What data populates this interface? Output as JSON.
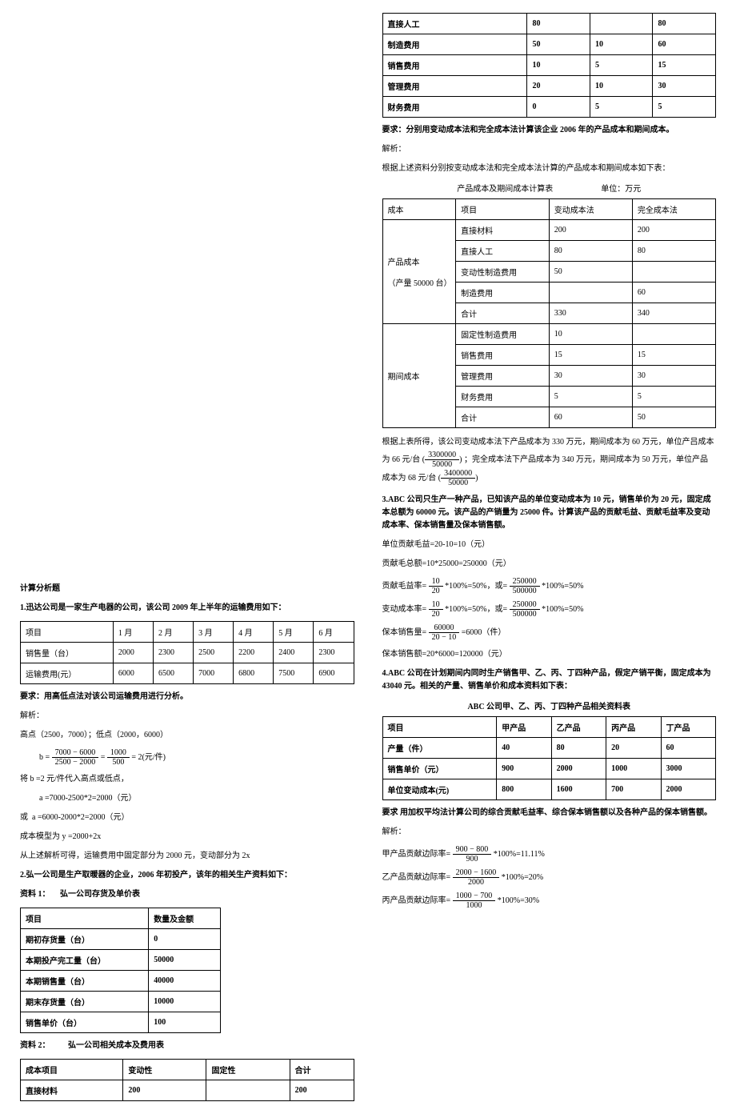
{
  "left": {
    "title": "计算分析题",
    "q1": {
      "stmt": "1.迅达公司是一家生产电器的公司，该公司 2009 年上半年的运输费用如下：",
      "table": {
        "h": [
          "项目",
          "1 月",
          "2 月",
          "3 月",
          "4 月",
          "5 月",
          "6 月"
        ],
        "r1": [
          "销售量（台）",
          "2000",
          "2300",
          "2500",
          "2200",
          "2400",
          "2300"
        ],
        "r2": [
          "运输费用(元）",
          "6000",
          "6500",
          "7000",
          "6800",
          "7500",
          "6900"
        ]
      },
      "req": "要求：用高低点法对该公司运输费用进行分析。",
      "sol_label": "解析：",
      "hl": "高点（2500，7000）；低点（2000，6000）",
      "b_num": "7000 − 6000",
      "b_den": "2500 − 2000",
      "b_num2": "1000",
      "b_den2": "500",
      "b_res": "= 2(元/件)",
      "sub": "将 b =2 元/件代入高点或低点，",
      "a1": "a =7000-2500*2=2000（元）",
      "a_or": "或",
      "a2": "a =6000-2000*2=2000（元）",
      "model": "成本模型为 y =2000+2x",
      "conc": "从上述解析可得，运输费用中固定部分为 2000 元，变动部分为 2x"
    },
    "q2": {
      "stmt": "2.弘一公司是生产取暖器的企业，2006 年初投产，该年的相关生产资料如下：",
      "mat1_label": "资料 1：",
      "mat1_title": "弘一公司存货及单价表",
      "t1": {
        "h": [
          "项目",
          "数量及金额"
        ],
        "r1": [
          "期初存货量（台）",
          "0"
        ],
        "r2": [
          "本期投产完工量（台）",
          "50000"
        ],
        "r3": [
          "本期销售量（台）",
          "40000"
        ],
        "r4": [
          "期末存货量（台）",
          "10000"
        ],
        "r5": [
          "销售单价（台）",
          "100"
        ]
      },
      "mat2_label": "资料 2：",
      "mat2_title": "弘一公司相关成本及费用表",
      "t2": {
        "h": [
          "成本项目",
          "变动性",
          "固定性",
          "合计"
        ],
        "r1": [
          "直接材料",
          "200",
          "",
          "200"
        ]
      }
    }
  },
  "right": {
    "t2cont": {
      "r2": [
        "直接人工",
        "80",
        "",
        "80"
      ],
      "r3": [
        "制造费用",
        "50",
        "10",
        "60"
      ],
      "r4": [
        "销售费用",
        "10",
        "5",
        "15"
      ],
      "r5": [
        "管理费用",
        "20",
        "10",
        "30"
      ],
      "r6": [
        "财务费用",
        "0",
        "5",
        "5"
      ]
    },
    "req2": "要求：分别用变动成本法和完全成本法计算该企业 2006 年的产品成本和期间成本。",
    "sol_label": "解析：",
    "intro": "根据上述资料分别按变动成本法和完全成本法计算的产品成本和期间成本如下表：",
    "cap_left": "产品成本及期间成本计算表",
    "cap_right": "单位：万元",
    "t3": {
      "h": [
        "成本",
        "项目",
        "变动成本法",
        "完全成本法"
      ],
      "g1_label": "产品成本",
      "g1_sub": "（产量 50000 台）",
      "g1_rows": [
        [
          "直接材料",
          "200",
          "200"
        ],
        [
          "直接人工",
          "80",
          "80"
        ],
        [
          "变动性制造费用",
          "50",
          ""
        ],
        [
          "制造费用",
          "",
          "60"
        ],
        [
          "合计",
          "330",
          "340"
        ]
      ],
      "g2_label": "期间成本",
      "g2_rows": [
        [
          "固定性制造费用",
          "10",
          ""
        ],
        [
          "销售费用",
          "15",
          "15"
        ],
        [
          "管理费用",
          "30",
          "30"
        ],
        [
          "财务费用",
          "5",
          "5"
        ],
        [
          "合计",
          "60",
          "50"
        ]
      ]
    },
    "conc2a": "根据上表所得，该公司变动成本法下产品成本为 330 万元，期间成本为 60 万元，单位产吕成本",
    "conc2a_pref": "为 66 元/台 (",
    "frac66_num": "3300000",
    "frac66_den": "50000",
    "conc2b": ") ；完全成本法下产品成本为 340 万元，期间成本为 50 万元，单位产品",
    "conc2c_pref": "成本为 68 元/台 (",
    "frac68_num": "3400000",
    "frac68_den": "50000",
    "conc2c_suf": ")",
    "q3": {
      "stmt": "3.ABC 公司只生产一种产品，已知该产品的单位变动成本为 10 元，销售单价为 20 元，固定成本总额为 60000 元。该产品的产销量为 25000 件。计算该产品的贡献毛益、贡献毛益率及变动成本率、保本销售量及保本销售额。",
      "l1": "单位贡献毛益=20-10=10（元）",
      "l2": "贡献毛总额=10*25000=250000（元）",
      "gm_label": "贡献毛益率=",
      "gm_n1": "10",
      "gm_d1": "20",
      "mid": " *100%=50%，或=",
      "gm_n2": "250000",
      "gm_d2": "500000",
      "tail": " *100%=50%",
      "vc_label": "变动成本率=",
      "vc_n1": "10",
      "vc_d1": "20",
      "vc_n2": "250000",
      "vc_d2": "500000",
      "bq_label": "保本销售量=",
      "bq_n": "60000",
      "bq_d": "20 − 10",
      "bq_res": " =6000（件）",
      "bs": "保本销售额=20*6000=120000（元）"
    },
    "q4": {
      "stmt": "4.ABC 公司在计划期间内同时生产销售甲、乙、丙、丁四种产品，假定产销平衡，固定成本为 43040 元。相关的产量、销售单价和成本资料如下表：",
      "cap": "ABC 公司甲、乙、丙、丁四种产品相关资料表",
      "h": [
        "项目",
        "甲产品",
        "乙产品",
        "丙产品",
        "丁产品"
      ],
      "r1": [
        "产量（件）",
        "40",
        "80",
        "20",
        "60"
      ],
      "r2": [
        "销售单价（元）",
        "900",
        "2000",
        "1000",
        "3000"
      ],
      "r3": [
        "单位变动成本(元)",
        "800",
        "1600",
        "700",
        "2000"
      ],
      "req": "要求 用加权平均法计算公司的综合贡献毛益率、综合保本销售额以及各种产品的保本销售额。",
      "sol_label": "解析：",
      "j_label": "甲产品贡献边际率=",
      "j_n": "900 − 800",
      "j_d": "900",
      "j_res": " *100%=11.11%",
      "y_label": "乙产品贡献边际率=",
      "y_n": "2000 − 1600",
      "y_d": "2000",
      "y_res": " *100%=20%",
      "b_label": "丙产品贡献边际率=",
      "b_n": "1000 − 700",
      "b_d": "1000",
      "b_res": " *100%=30%"
    }
  },
  "chart_data": [
    {
      "type": "table",
      "title": "运输费用",
      "categories": [
        "1月",
        "2月",
        "3月",
        "4月",
        "5月",
        "6月"
      ],
      "series": [
        {
          "name": "销售量（台）",
          "values": [
            2000,
            2300,
            2500,
            2200,
            2400,
            2300
          ]
        },
        {
          "name": "运输费用(元）",
          "values": [
            6000,
            6500,
            7000,
            6800,
            7500,
            6900
          ]
        }
      ]
    },
    {
      "type": "table",
      "title": "弘一公司存货及单价表",
      "rows": [
        [
          "期初存货量（台）",
          0
        ],
        [
          "本期投产完工量（台）",
          50000
        ],
        [
          "本期销售量（台）",
          40000
        ],
        [
          "期末存货量（台）",
          10000
        ],
        [
          "销售单价（台）",
          100
        ]
      ]
    },
    {
      "type": "table",
      "title": "弘一公司相关成本及费用表",
      "columns": [
        "成本项目",
        "变动性",
        "固定性",
        "合计"
      ],
      "rows": [
        [
          "直接材料",
          200,
          null,
          200
        ],
        [
          "直接人工",
          80,
          null,
          80
        ],
        [
          "制造费用",
          50,
          10,
          60
        ],
        [
          "销售费用",
          10,
          5,
          15
        ],
        [
          "管理费用",
          20,
          10,
          30
        ],
        [
          "财务费用",
          0,
          5,
          5
        ]
      ]
    },
    {
      "type": "table",
      "title": "产品成本及期间成本计算表",
      "unit": "万元",
      "columns": [
        "成本",
        "项目",
        "变动成本法",
        "完全成本法"
      ],
      "rows": [
        [
          "产品成本",
          "直接材料",
          200,
          200
        ],
        [
          "",
          "直接人工",
          80,
          80
        ],
        [
          "",
          "变动性制造费用",
          50,
          null
        ],
        [
          "",
          "制造费用",
          null,
          60
        ],
        [
          "",
          "合计",
          330,
          340
        ],
        [
          "期间成本",
          "固定性制造费用",
          10,
          null
        ],
        [
          "",
          "销售费用",
          15,
          15
        ],
        [
          "",
          "管理费用",
          30,
          30
        ],
        [
          "",
          "财务费用",
          5,
          5
        ],
        [
          "",
          "合计",
          60,
          50
        ]
      ]
    },
    {
      "type": "table",
      "title": "ABC 公司甲、乙、丙、丁四种产品相关资料表",
      "columns": [
        "项目",
        "甲产品",
        "乙产品",
        "丙产品",
        "丁产品"
      ],
      "rows": [
        [
          "产量（件）",
          40,
          80,
          20,
          60
        ],
        [
          "销售单价（元）",
          900,
          2000,
          1000,
          3000
        ],
        [
          "单位变动成本(元)",
          800,
          1600,
          700,
          2000
        ]
      ]
    }
  ]
}
